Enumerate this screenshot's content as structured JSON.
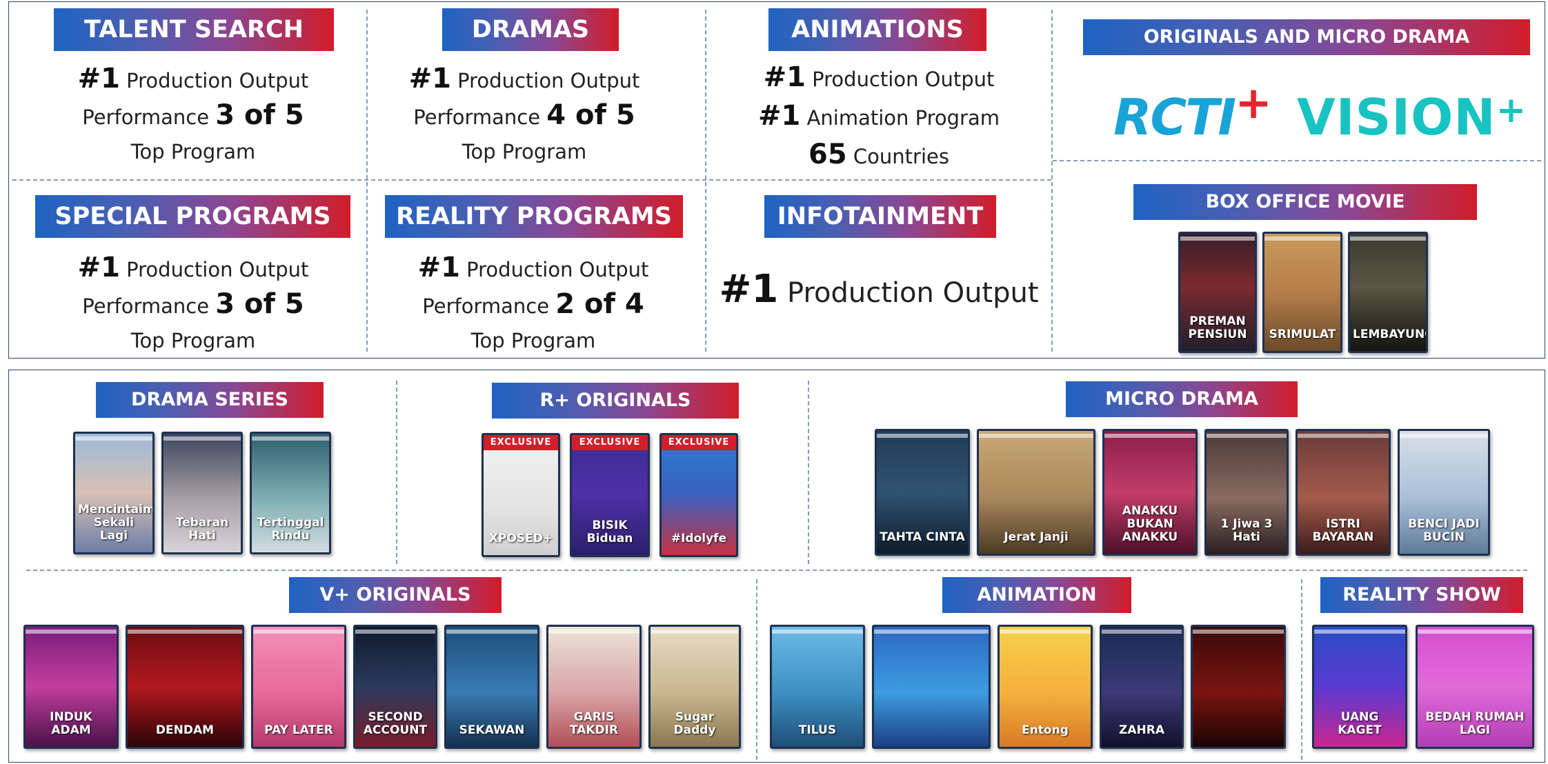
{
  "top": {
    "talent_search": {
      "label": "TALENT SEARCH",
      "line1_bold": "#1",
      "line1_text": " Production Output",
      "line2_text": "Performance ",
      "line2_bold": "3 of 5",
      "line3_text": "Top Program"
    },
    "dramas": {
      "label": "DRAMAS",
      "line1_bold": "#1",
      "line1_text": " Production Output",
      "line2_text": "Performance ",
      "line2_bold": "4 of 5",
      "line3_text": "Top Program"
    },
    "animations": {
      "label": "ANIMATIONS",
      "line1_bold": "#1",
      "line1_text": " Production Output",
      "line2_bold": "#1",
      "line2_text": " Animation Program",
      "line3_bold": "65",
      "line3_text": " Countries"
    },
    "originals": {
      "label": "ORIGINALS AND MICRO DRAMA",
      "logo_rcti": "RCTI",
      "logo_rcti_plus": "+",
      "logo_vision": "VISION",
      "logo_vision_plus": "+"
    },
    "special_programs": {
      "label": "SPECIAL PROGRAMS",
      "line1_bold": "#1",
      "line1_text": " Production Output",
      "line2_text": "Performance ",
      "line2_bold": "3 of 5",
      "line3_text": "Top Program"
    },
    "reality_programs": {
      "label": "REALITY PROGRAMS",
      "line1_bold": "#1",
      "line1_text": " Production Output",
      "line2_text": "Performance ",
      "line2_bold": "2 of 4",
      "line3_text": "Top Program"
    },
    "infotainment": {
      "label": "INFOTAINMENT",
      "line1_bold": "#1",
      "line1_text": " Production Output"
    },
    "box_office": {
      "label": "BOX OFFICE MOVIE",
      "posters": [
        {
          "title": "PREMAN PENSIUN",
          "bg": "linear-gradient(180deg,#3a1c2a 0%,#7a2a2f 45%,#20202c 100%)"
        },
        {
          "title": "SRIMULAT",
          "bg": "linear-gradient(180deg,#c89a5a 0%,#b67e49 50%,#6b4a2b 100%)"
        },
        {
          "title": "LEMBAYUNG",
          "bg": "linear-gradient(180deg,#3b3a2f 0%,#5a5645 45%,#14140f 100%)"
        }
      ]
    }
  },
  "bottom": {
    "drama_series": {
      "label": "DRAMA SERIES",
      "posters": [
        {
          "title": "Mencintaimu Sekali Lagi",
          "bg": "linear-gradient(180deg,#9fb9d6 0%,#d8c1b5 50%,#6c7ea8 100%)"
        },
        {
          "title": "Tebaran Hati",
          "bg": "linear-gradient(180deg,#3c465d 0%,#a7a0a4 55%,#d9d4d8 100%)"
        },
        {
          "title": "Tertinggal Rindu",
          "bg": "linear-gradient(180deg,#2d5e6d 0%,#7fb0b3 55%,#d0dce0 100%)"
        }
      ]
    },
    "r_originals": {
      "label": "R+ ORIGINALS",
      "exclusive": "EXCLUSIVE",
      "posters": [
        {
          "title": "XPOSED+",
          "bg": "linear-gradient(180deg,#f2f2f2 0%,#e4e4e4 60%,#cfcfcf 100%)"
        },
        {
          "title": "BISIK Biduan",
          "bg": "linear-gradient(180deg,#3b2c8f 0%,#4f2fa8 50%,#2a1f6a 100%)"
        },
        {
          "title": "#Idolyfe",
          "bg": "linear-gradient(180deg,#2a7fd4 0%,#3a5fbc 50%,#c73342 100%)"
        }
      ]
    },
    "micro_drama": {
      "label": "MICRO DRAMA",
      "posters": [
        {
          "title": "TAHTA CINTA",
          "bg": "linear-gradient(180deg,#1f3a55 0%,#2f5473 50%,#0f1c2b 100%)"
        },
        {
          "title": "Jerat Janji",
          "bg": "linear-gradient(180deg,#c9a877 0%,#a8875a 55%,#4b3a25 100%)"
        },
        {
          "title": "ANAKKU BUKAN ANAKKU",
          "bg": "linear-gradient(180deg,#8d1d4a 0%,#c23d6a 50%,#4d1028 100%)"
        },
        {
          "title": "1 Jiwa 3 Hati",
          "bg": "linear-gradient(180deg,#4a3a38 0%,#8a6b62 55%,#2a201f 100%)"
        },
        {
          "title": "ISTRI BAYARAN",
          "bg": "linear-gradient(180deg,#6b3a3a 0%,#a35b4b 55%,#3b1c1c 100%)"
        },
        {
          "title": "BENCI JADI BUCIN",
          "bg": "linear-gradient(180deg,#d8dfe8 0%,#a9c0d7 55%,#5f7a98 100%)"
        }
      ]
    },
    "v_originals": {
      "label": "V+ ORIGINALS",
      "posters": [
        {
          "title": "INDUK ADAM",
          "bg": "linear-gradient(180deg,#7b1e7a 0%,#c23d9e 50%,#4a1248 100%)"
        },
        {
          "title": "DENDAM",
          "bg": "linear-gradient(180deg,#6a0d12 0%,#b3171e 50%,#2b0507 100%)"
        },
        {
          "title": "PAY LATER",
          "bg": "linear-gradient(180deg,#f28fb5 0%,#e76a9a 55%,#b43b6c 100%)"
        },
        {
          "title": "SECOND ACCOUNT",
          "bg": "linear-gradient(180deg,#101a2e 0%,#2b3a5d 50%,#7a1d2a 100%)"
        },
        {
          "title": "SEKAWAN",
          "bg": "linear-gradient(180deg,#1b4d7a 0%,#3a7cb3 55%,#13304f 100%)"
        },
        {
          "title": "GARIS TAKDIR",
          "bg": "linear-gradient(180deg,#e9e3d8 0%,#d9a5a8 55%,#b24f55 100%)"
        },
        {
          "title": "Sugar Daddy",
          "bg": "linear-gradient(180deg,#e6dcc4 0%,#c9b78f 55%,#8a774f 100%)"
        }
      ]
    },
    "animation": {
      "label": "ANIMATION",
      "posters": [
        {
          "title": "TILUS",
          "bg": "linear-gradient(180deg,#6bbbe5 0%,#3d8fc3 55%,#1e4f76 100%)"
        },
        {
          "title": "",
          "bg": "linear-gradient(180deg,#2c68c2 0%,#3e9ce0 55%,#1c3f84 100%)"
        },
        {
          "title": "Entong",
          "bg": "linear-gradient(180deg,#f7d04b 0%,#f3b13d 55%,#d87a27 100%)"
        },
        {
          "title": "ZAHRA",
          "bg": "linear-gradient(180deg,#1a2b52 0%,#3c3a78 55%,#120f2b 100%)"
        },
        {
          "title": "",
          "bg": "linear-gradient(180deg,#3a0a0a 0%,#7a1410 55%,#1a0404 100%)"
        }
      ]
    },
    "reality_show": {
      "label": "REALITY SHOW",
      "posters": [
        {
          "title": "UANG KAGET",
          "bg": "linear-gradient(180deg,#2b4bc7 0%,#5a3ad0 50%,#c9268f 100%)"
        },
        {
          "title": "BEDAH RUMAH LAGI",
          "bg": "linear-gradient(180deg,#d64fd0 0%,#e36ad9 50%,#b23fb4 100%)"
        }
      ]
    }
  }
}
